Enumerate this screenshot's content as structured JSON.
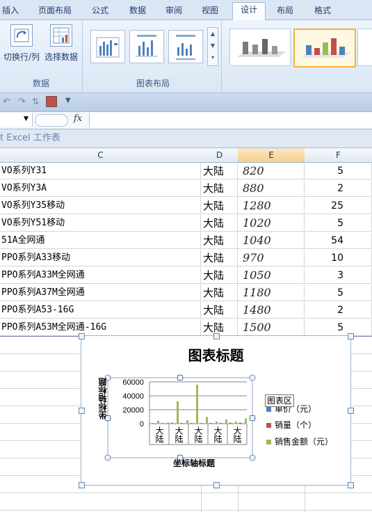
{
  "ribbon": {
    "tabs": [
      "插入",
      "页面布局",
      "公式",
      "数据",
      "审阅",
      "视图",
      "设计",
      "布局",
      "格式"
    ],
    "active_tab": "设计",
    "groups": {
      "data": {
        "label": "数据",
        "switch_label": "切换行/列",
        "select_label": "选择数据"
      },
      "layout": {
        "label": "图表布局"
      }
    }
  },
  "formula_bar": {
    "fx": "fx",
    "value": ""
  },
  "workbook_title": "t Excel 工作表",
  "columns": [
    "C",
    "D",
    "E",
    "F"
  ],
  "rows": [
    {
      "c": "VO系列Y31",
      "d": "大陆",
      "e": "820",
      "f": "5"
    },
    {
      "c": "VO系列Y3A",
      "d": "大陆",
      "e": "880",
      "f": "2"
    },
    {
      "c": "VO系列Y35移动",
      "d": "大陆",
      "e": "1280",
      "f": "25"
    },
    {
      "c": "VO系列Y51移动",
      "d": "大陆",
      "e": "1020",
      "f": "5"
    },
    {
      "c": "51A全网通",
      "d": "大陆",
      "e": "1040",
      "f": "54"
    },
    {
      "c": "PPO系列A33移动",
      "d": "大陆",
      "e": "970",
      "f": "10"
    },
    {
      "c": "PPO系列A33M全网通",
      "d": "大陆",
      "e": "1050",
      "f": "3"
    },
    {
      "c": "PPO系列A37M全网通",
      "d": "大陆",
      "e": "1180",
      "f": "5"
    },
    {
      "c": "PPO系列A53-16G",
      "d": "大陆",
      "e": "1480",
      "f": "2"
    },
    {
      "c": "PPO系列A53M全网通-16G",
      "d": "大陆",
      "e": "1500",
      "f": "5"
    }
  ],
  "chart": {
    "title": "图表标题",
    "tooltip": "图表区",
    "colors": {
      "unit_price": "#4f81bd",
      "quantity": "#c0504d",
      "amount": "#9bbb59"
    }
  },
  "chart_data": {
    "type": "bar",
    "title": "图表标题",
    "xlabel": "坐标轴标题",
    "ylabel": "坐标轴标题",
    "ylim": [
      0,
      60000
    ],
    "yticks": [
      "0",
      "20000",
      "40000",
      "60000"
    ],
    "categories": [
      "大陆",
      "大陆",
      "大陆",
      "大陆",
      "大陆",
      "大陆",
      "大陆",
      "大陆",
      "大陆",
      "大陆"
    ],
    "x_tick_labels_visible": [
      "大陆",
      "大陆",
      "大陆",
      "大陆",
      "大陆"
    ],
    "series": [
      {
        "name": "单价（元）",
        "values": [
          820,
          880,
          1280,
          1020,
          1040,
          970,
          1050,
          1180,
          1480,
          1500
        ]
      },
      {
        "name": "销量（个）",
        "values": [
          5,
          2,
          25,
          5,
          54,
          10,
          3,
          5,
          2,
          5
        ]
      },
      {
        "name": "销售金额（元）",
        "values": [
          4100,
          1760,
          32000,
          5100,
          56160,
          9700,
          3150,
          5900,
          2960,
          7500
        ]
      }
    ],
    "legend_position": "right",
    "grid": true
  }
}
